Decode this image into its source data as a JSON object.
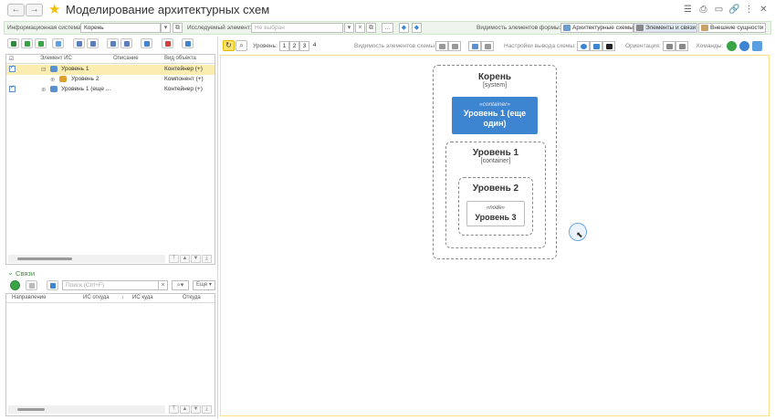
{
  "window": {
    "title": "Моделирование архитектурных схем",
    "back_icon": "←",
    "forward_icon": "→",
    "star_icon": "★",
    "controls": [
      "☰",
      "⎙",
      "▭",
      "🔗",
      "⋮",
      "✕"
    ]
  },
  "filter_bar": {
    "info_system_label": "Информационная система:",
    "info_system_value": "Корень",
    "element_label": "Исследуемый элемент:",
    "element_placeholder": "Не выбран",
    "more_btn": "...",
    "visibility_label": "Видимость элементов формы:",
    "tabs": [
      {
        "label": "Архитектурные схемы",
        "active": false
      },
      {
        "label": "Элементы и связи",
        "active": true
      },
      {
        "label": "Внешние сущности",
        "active": false
      }
    ]
  },
  "tree": {
    "columns": [
      "Элемент ИС",
      "Описание",
      "Вид объекта"
    ],
    "rows": [
      {
        "name": "Уровень 1",
        "kind": "Контейнер (+)",
        "selected": true
      },
      {
        "name": "Уровень 2",
        "kind": "Компонент (+)",
        "selected": false
      },
      {
        "name": "Уровень 1 (еще ...",
        "kind": "Контейнер (+)",
        "selected": false
      }
    ]
  },
  "links": {
    "section_title": "Связи",
    "search_placeholder": "Поиск (Ctrl+F)",
    "more_btn": "Еще",
    "columns": [
      "Направление",
      "ИС откуда",
      "ИС куда",
      "Откуда"
    ]
  },
  "scheme_toolbar": {
    "level_label": "Уровень:",
    "levels": [
      "1",
      "2",
      "3",
      "4"
    ],
    "visibility_label": "Видимость элементов схемы:",
    "output_label": "Настройки вывода схемы:",
    "orientation_label": "Ориентация:",
    "commands_label": "Команды:"
  },
  "diagram": {
    "root_title": "Корень",
    "root_type": "[system]",
    "container_stereotype": "«container»",
    "container_title": "Уровень 1 (еще один)",
    "level1_title": "Уровень 1",
    "level1_type": "[container]",
    "level2_title": "Уровень 2",
    "node_stereotype": "«node»",
    "node_title": "Уровень 3"
  },
  "colors": {
    "accent_blue": "#3d84d1",
    "selection": "#fbedb0",
    "filter_bg": "#edf5ec",
    "canvas_border": "#ffe08a",
    "green": "#3aa346"
  }
}
